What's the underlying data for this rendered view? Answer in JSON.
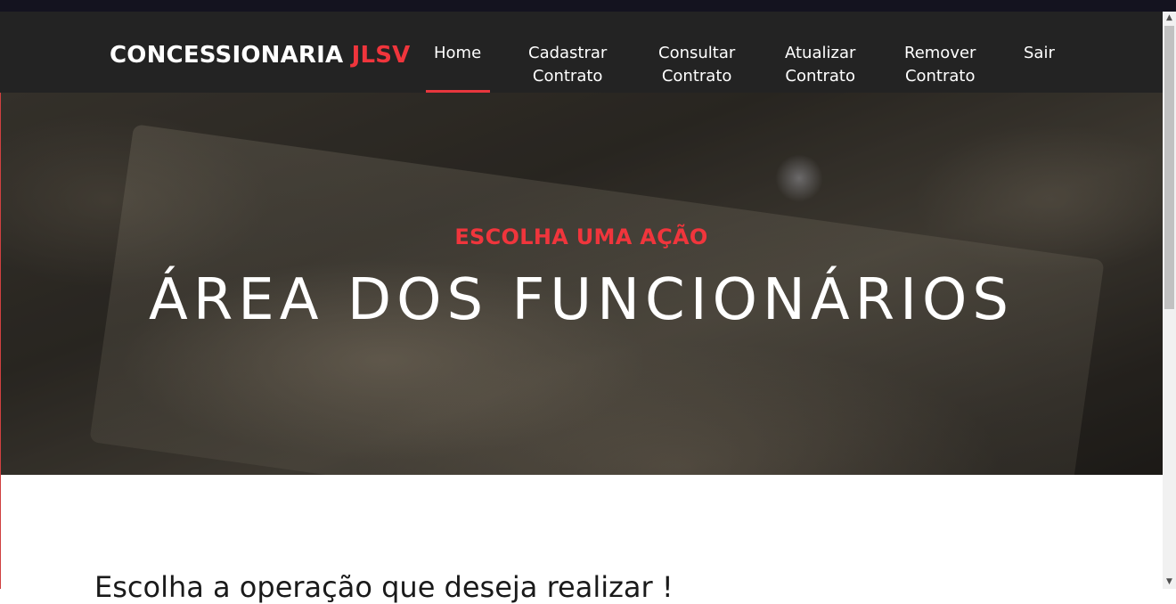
{
  "brand": {
    "name": "CONCESSIONARIA",
    "accent": "JLSV"
  },
  "nav": {
    "home": {
      "line1": "Home"
    },
    "cadastrar": {
      "line1": "Cadastrar",
      "line2": "Contrato"
    },
    "consultar": {
      "line1": "Consultar",
      "line2": "Contrato"
    },
    "atualizar": {
      "line1": "Atualizar",
      "line2": "Contrato"
    },
    "remover": {
      "line1": "Remover",
      "line2": "Contrato"
    },
    "sair": {
      "line1": "Sair"
    },
    "active": "Home"
  },
  "hero": {
    "subtitle": "ESCOLHA UMA AÇÃO",
    "title": "ÁREA DOS FUNCIONÁRIOS"
  },
  "content": {
    "prompt": "Escolha a operação que deseja realizar !"
  },
  "colors": {
    "accent": "#f0353c",
    "navbar": "#232323",
    "text_light": "#ffffff"
  },
  "icons": {
    "scroll_up": "triangle-up",
    "scroll_down": "triangle-down"
  }
}
